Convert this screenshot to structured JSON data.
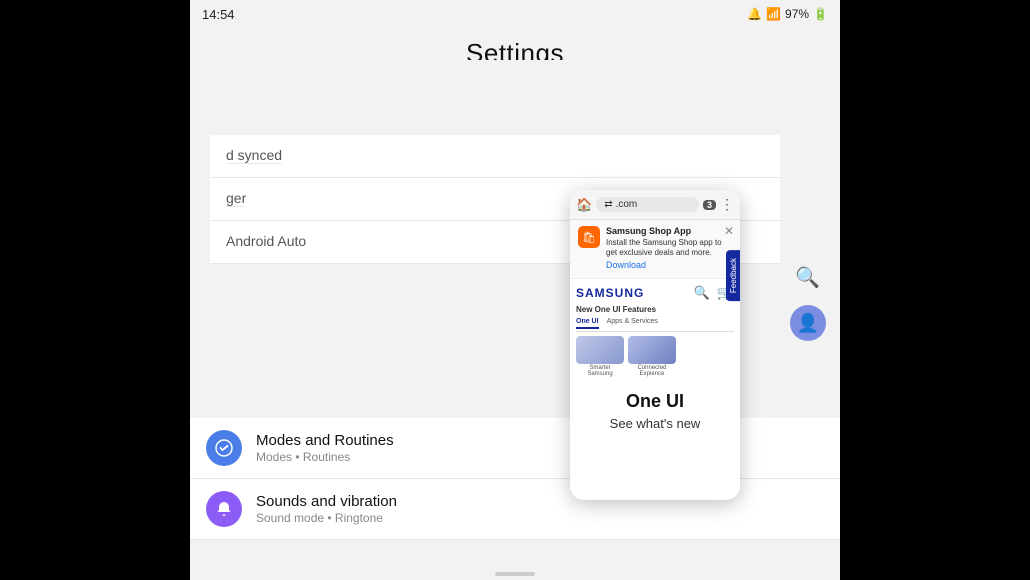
{
  "statusBar": {
    "time": "14:54",
    "batteryLevel": "97%",
    "icons": "🔔📶📱"
  },
  "header": {
    "title": "Settings",
    "underlineColor": "#1a73e8"
  },
  "browser": {
    "urlBar": ".com",
    "tabCount": "3",
    "notification": {
      "appName": "Samsung Shop App",
      "description": "Install the Samsung Shop app to get exclusive deals and more.",
      "downloadLabel": "Download"
    },
    "samsungContent": {
      "logo": "SAMSUNG",
      "section": "New One UI Features",
      "tabs": [
        "One UI",
        "Apps & Services"
      ],
      "heading": "One UI",
      "subheading": "See what's new"
    },
    "feedbackLabel": "Feedback"
  },
  "rightPanel": {
    "searchIcon": "🔍",
    "avatarIcon": "👤"
  },
  "partialItems": {
    "synced": "d synced",
    "ger": "ger",
    "androidAuto": "Android Auto"
  },
  "settingsItems": [
    {
      "id": "modes-routines",
      "icon": "✓",
      "iconBg": "#4a7de8",
      "title": "Modes and Routines",
      "subtitle": "Modes • Routines"
    },
    {
      "id": "sounds-vibration",
      "icon": "🔔",
      "iconBg": "#8b5cf6",
      "title": "Sounds and vibration",
      "subtitle": "Sound mode • Ringtone"
    }
  ],
  "scrollIndicator": {
    "visible": true
  }
}
